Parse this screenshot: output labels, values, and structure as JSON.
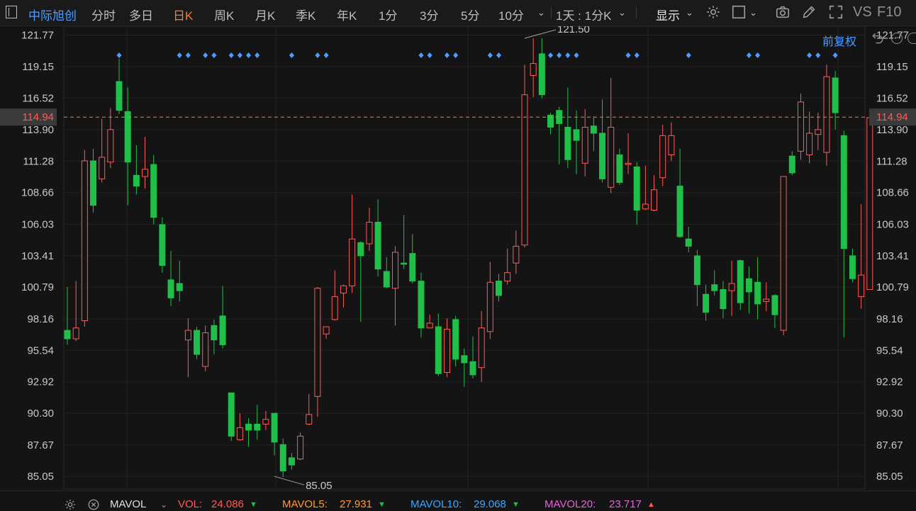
{
  "toolbar": {
    "stock_name": "中际旭创",
    "tabs": [
      {
        "label": "分时",
        "active": false
      },
      {
        "label": "多日",
        "active": false
      },
      {
        "label": "日K",
        "active": true
      },
      {
        "label": "周K",
        "active": false
      },
      {
        "label": "月K",
        "active": false
      },
      {
        "label": "季K",
        "active": false
      },
      {
        "label": "年K",
        "active": false
      },
      {
        "label": "1分",
        "active": false
      },
      {
        "label": "3分",
        "active": false
      },
      {
        "label": "5分",
        "active": false
      },
      {
        "label": "10分",
        "active": false
      }
    ],
    "period_select": "1天 : 1分K",
    "display_label": "显示",
    "vs_label": "VS",
    "f10_label": "F10"
  },
  "price_adjust": "前复权",
  "current_price_label": "114.94",
  "colors": {
    "up": "#ff5a5a",
    "down": "#1fbf4a",
    "accent": "#ff7a2e",
    "link": "#4f9cff",
    "marker": "#4f9cff"
  },
  "chart_data": {
    "type": "candlestick",
    "y_ticks": [
      "121.77",
      "119.15",
      "116.52",
      "113.90",
      "111.28",
      "108.66",
      "106.03",
      "103.41",
      "100.79",
      "98.16",
      "95.54",
      "92.92",
      "90.30",
      "87.67",
      "85.05"
    ],
    "ylim": [
      84.0,
      122.5
    ],
    "current_price": 114.94,
    "max_annotation": {
      "label": "121.50",
      "value": 121.5,
      "index": 53
    },
    "min_annotation": {
      "label": "85.05",
      "value": 85.05,
      "index": 24
    },
    "markers": [
      6,
      13,
      14,
      16,
      17,
      19,
      20,
      21,
      22,
      26,
      29,
      30,
      41,
      42,
      44,
      45,
      49,
      50,
      55,
      56,
      57,
      58,
      59,
      65,
      66,
      72,
      79,
      80,
      86,
      87,
      89
    ],
    "candles": [
      [
        97.2,
        96.5,
        100.8,
        96.0
      ],
      [
        96.5,
        97.4,
        101.3,
        96.3
      ],
      [
        98.0,
        111.3,
        112.2,
        97.5
      ],
      [
        111.3,
        107.6,
        112.3,
        107.0
      ],
      [
        109.8,
        111.6,
        114.8,
        109.5
      ],
      [
        111.2,
        113.9,
        115.7,
        110.7
      ],
      [
        117.9,
        115.5,
        119.8,
        115.2
      ],
      [
        115.4,
        111.2,
        117.4,
        107.6
      ],
      [
        110.1,
        109.2,
        112.6,
        108.5
      ],
      [
        110.0,
        110.6,
        113.3,
        109.0
      ],
      [
        111.0,
        106.6,
        111.8,
        106.0
      ],
      [
        106.0,
        102.6,
        106.6,
        102.0
      ],
      [
        101.4,
        99.9,
        103.8,
        99.2
      ],
      [
        101.1,
        100.5,
        103.0,
        99.6
      ],
      [
        96.4,
        97.2,
        98.2,
        93.3
      ],
      [
        97.2,
        95.2,
        97.5,
        94.8
      ],
      [
        94.2,
        97.0,
        97.6,
        93.8
      ],
      [
        97.6,
        96.4,
        98.1,
        95.2
      ],
      [
        98.4,
        96.0,
        100.9,
        95.7
      ],
      [
        92.0,
        88.4,
        92.0,
        88.0
      ],
      [
        88.1,
        89.1,
        90.3,
        88.0
      ],
      [
        89.4,
        88.9,
        89.9,
        87.5
      ],
      [
        89.4,
        88.9,
        91.0,
        88.1
      ],
      [
        89.4,
        89.8,
        90.5,
        88.9
      ],
      [
        90.3,
        87.9,
        90.3,
        86.8
      ],
      [
        87.7,
        85.5,
        88.2,
        85.0
      ],
      [
        86.6,
        86.0,
        87.0,
        85.6
      ],
      [
        86.5,
        88.4,
        88.7,
        86.4
      ],
      [
        89.4,
        90.2,
        91.9,
        89.3
      ],
      [
        91.7,
        100.7,
        100.8,
        90.0
      ],
      [
        96.9,
        97.5,
        97.5,
        96.5
      ],
      [
        98.1,
        100.0,
        102.2,
        98.0
      ],
      [
        100.3,
        100.9,
        101.0,
        99.1
      ],
      [
        100.9,
        104.8,
        108.5,
        100.3
      ],
      [
        104.5,
        103.4,
        104.6,
        97.9
      ],
      [
        104.4,
        106.2,
        107.4,
        103.8
      ],
      [
        106.2,
        102.3,
        108.1,
        101.7
      ],
      [
        102.1,
        100.8,
        103.3,
        100.7
      ],
      [
        100.7,
        103.7,
        104.2,
        97.6
      ],
      [
        102.8,
        102.7,
        106.8,
        102.3
      ],
      [
        103.6,
        101.3,
        105.2,
        101.1
      ],
      [
        101.3,
        97.4,
        102.0,
        96.6
      ],
      [
        97.4,
        97.8,
        98.5,
        97.4
      ],
      [
        97.5,
        93.6,
        98.6,
        93.4
      ],
      [
        93.7,
        97.3,
        98.2,
        93.3
      ],
      [
        98.1,
        94.8,
        98.4,
        94.2
      ],
      [
        95.1,
        94.5,
        95.7,
        92.5
      ],
      [
        94.6,
        93.5,
        96.7,
        93.2
      ],
      [
        94.1,
        97.4,
        98.8,
        92.9
      ],
      [
        97.1,
        101.2,
        102.9,
        96.5
      ],
      [
        101.3,
        100.1,
        101.9,
        99.6
      ],
      [
        101.3,
        102.0,
        104.0,
        101.0
      ],
      [
        102.8,
        104.2,
        105.5,
        101.9
      ],
      [
        104.3,
        116.8,
        119.3,
        104.1
      ],
      [
        118.4,
        119.4,
        121.5,
        116.6
      ],
      [
        120.2,
        116.8,
        121.5,
        116.5
      ],
      [
        115.1,
        114.1,
        115.3,
        113.5
      ],
      [
        115.5,
        114.4,
        115.8,
        111.0
      ],
      [
        114.1,
        111.4,
        117.4,
        110.7
      ],
      [
        113.9,
        113.0,
        115.5,
        110.2
      ],
      [
        111.1,
        114.1,
        115.6,
        110.0
      ],
      [
        114.2,
        113.6,
        115.0,
        112.1
      ],
      [
        113.6,
        109.8,
        116.4,
        109.5
      ],
      [
        109.1,
        114.1,
        118.2,
        108.6
      ],
      [
        111.8,
        109.5,
        112.3,
        109.3
      ],
      [
        111.0,
        111.1,
        113.6,
        110.2
      ],
      [
        110.8,
        107.2,
        111.2,
        106.0
      ],
      [
        107.3,
        107.7,
        110.9,
        107.2
      ],
      [
        107.2,
        108.9,
        110.1,
        107.1
      ],
      [
        109.9,
        113.4,
        114.3,
        109.2
      ],
      [
        111.8,
        113.4,
        114.5,
        111.3
      ],
      [
        109.2,
        105.0,
        112.3,
        104.9
      ],
      [
        104.8,
        104.2,
        105.8,
        103.7
      ],
      [
        103.4,
        101.0,
        103.9,
        99.2
      ],
      [
        100.2,
        98.7,
        101.0,
        98.0
      ],
      [
        101.0,
        100.5,
        102.2,
        100.1
      ],
      [
        100.6,
        99.0,
        101.3,
        98.2
      ],
      [
        100.5,
        101.1,
        103.0,
        98.4
      ],
      [
        103.0,
        99.5,
        103.1,
        98.9
      ],
      [
        101.5,
        100.4,
        102.5,
        98.6
      ],
      [
        101.2,
        99.4,
        103.3,
        98.1
      ],
      [
        99.6,
        99.8,
        101.2,
        98.8
      ],
      [
        100.1,
        98.5,
        100.2,
        97.4
      ],
      [
        97.2,
        110.0,
        110.0,
        96.8
      ],
      [
        111.7,
        110.3,
        112.1,
        110.1
      ],
      [
        112.1,
        116.2,
        116.9,
        111.4
      ],
      [
        111.8,
        113.6,
        115.4,
        111.1
      ],
      [
        113.5,
        113.9,
        115.3,
        112.2
      ],
      [
        112.0,
        118.3,
        119.3,
        110.9
      ],
      [
        118.2,
        115.3,
        118.8,
        113.9
      ],
      [
        113.4,
        104.0,
        113.8,
        96.6
      ],
      [
        103.4,
        101.5,
        104.0,
        101.2
      ],
      [
        100.0,
        101.8,
        107.7,
        99.0
      ],
      [
        100.6,
        114.9,
        115.0,
        101.5
      ]
    ]
  },
  "bottom_bar": {
    "indicator": "MAVOL",
    "vol_label": "VOL:",
    "vol_value": "24.086",
    "mavol5_label": "MAVOL5:",
    "mavol5_value": "27.931",
    "mavol10_label": "MAVOL10:",
    "mavol10_value": "29.068",
    "mavol20_label": "MAVOL20:",
    "mavol20_value": "23.717"
  }
}
